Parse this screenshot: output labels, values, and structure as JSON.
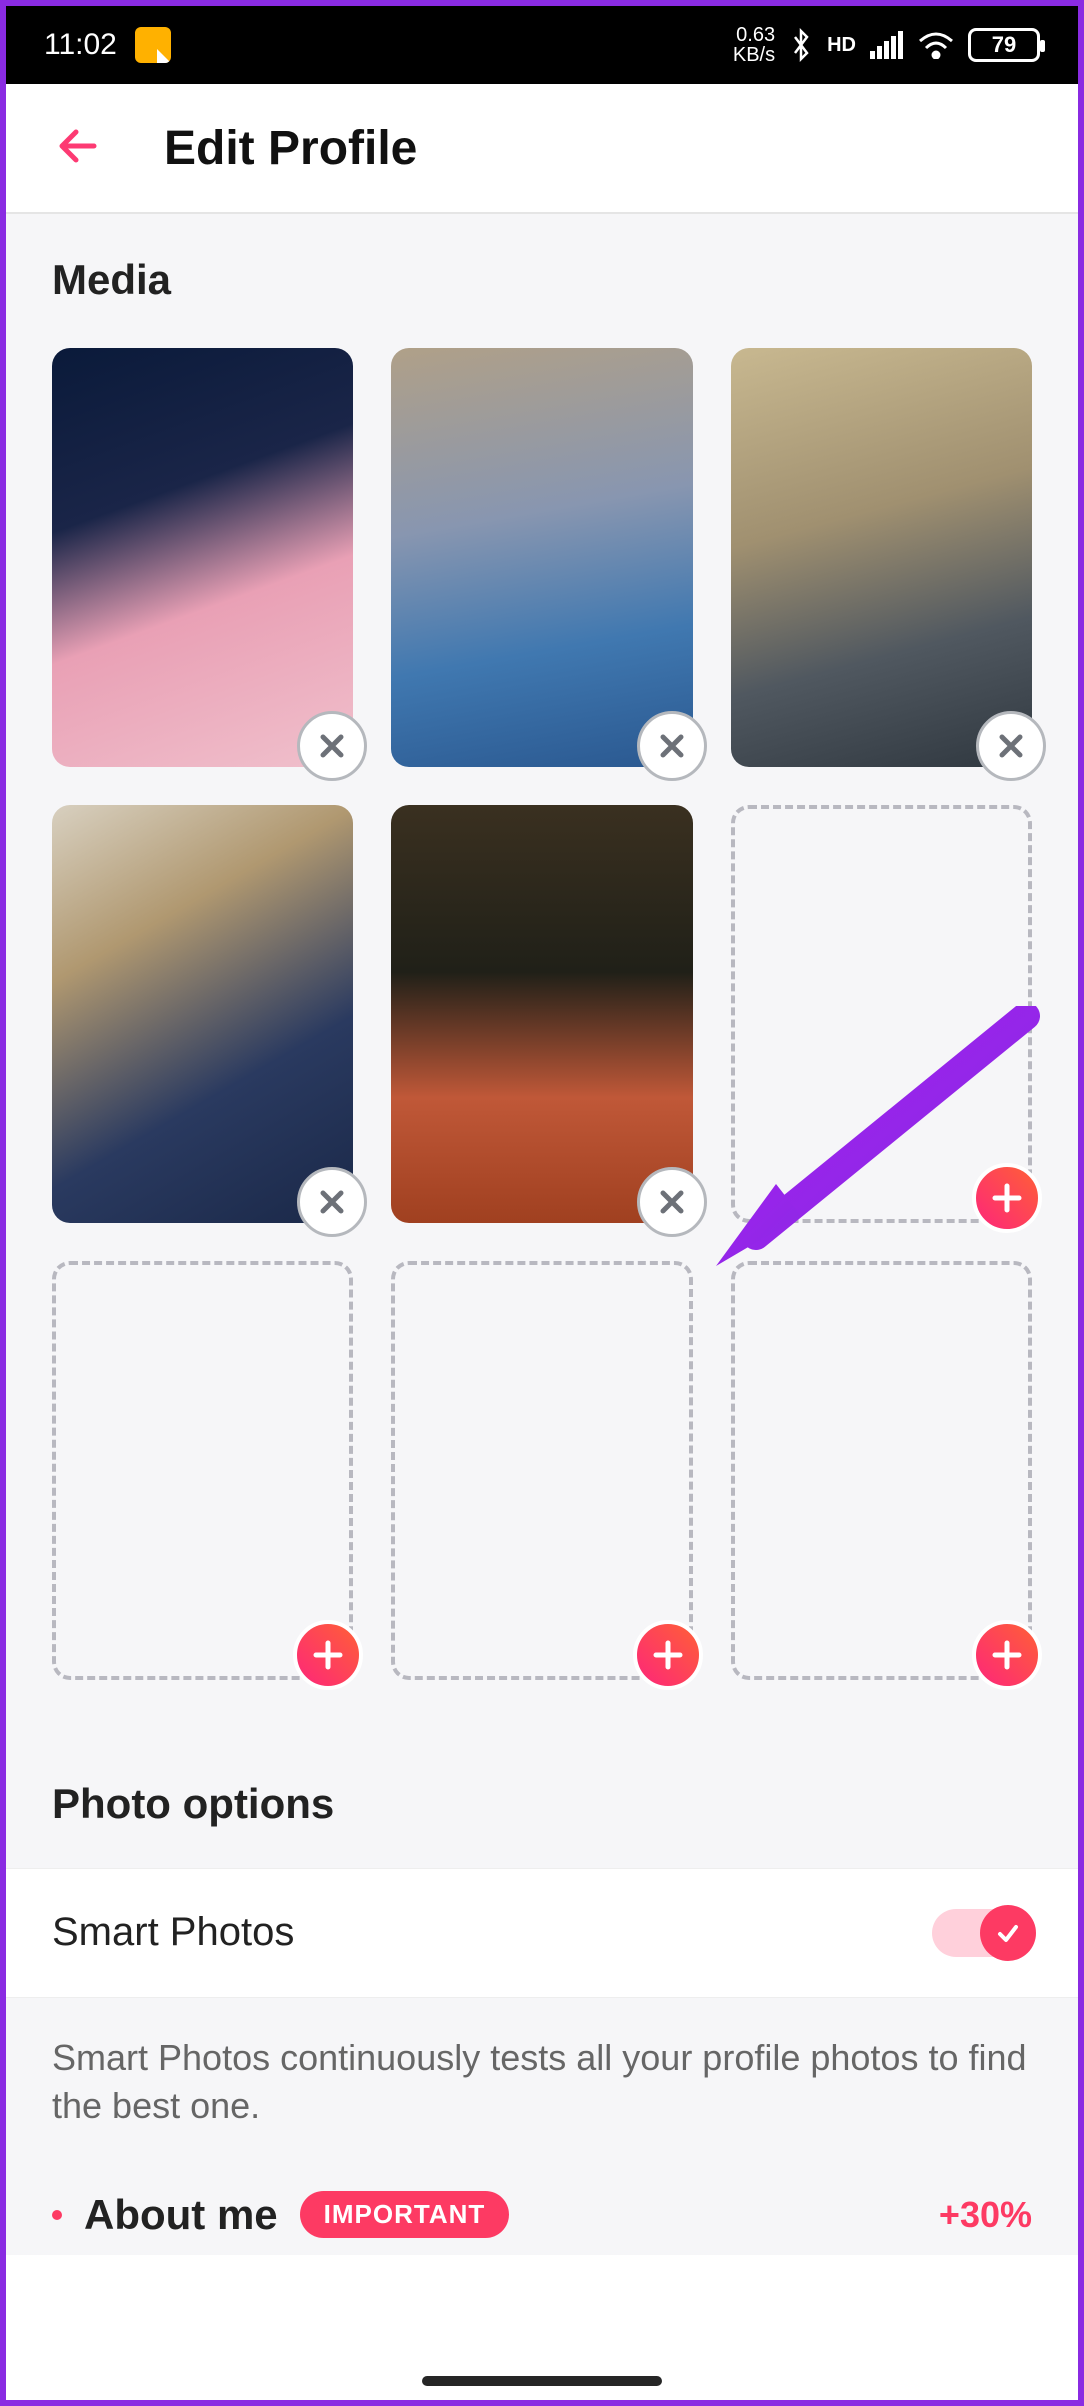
{
  "status": {
    "time": "11:02",
    "kb_top": "0.63",
    "kb_bot": "KB/s",
    "hd": "HD",
    "battery": "79"
  },
  "header": {
    "title": "Edit Profile"
  },
  "sections": {
    "media_title": "Media",
    "photo_options_title": "Photo options",
    "smart_photos_label": "Smart Photos",
    "smart_photos_tip": "Smart Photos continuously tests all your profile photos to find the best one."
  },
  "media_slots": [
    {
      "filled": true,
      "photo_class": "p1"
    },
    {
      "filled": true,
      "photo_class": "p2"
    },
    {
      "filled": true,
      "photo_class": "p3"
    },
    {
      "filled": true,
      "photo_class": "p4"
    },
    {
      "filled": true,
      "photo_class": "p5"
    },
    {
      "filled": false
    },
    {
      "filled": false
    },
    {
      "filled": false
    },
    {
      "filled": false
    }
  ],
  "about": {
    "title": "About me",
    "pill": "IMPORTANT",
    "boost": "+30%"
  },
  "smart_photos_enabled": true,
  "annotation_arrow_target": "slot 5 remove button"
}
